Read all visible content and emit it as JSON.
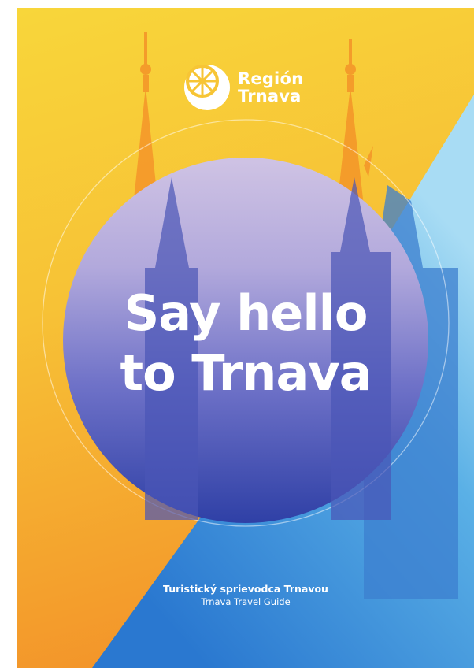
{
  "brand": {
    "line1": "Región",
    "line2": "Trnava"
  },
  "headline": {
    "line1": "Say hello",
    "line2": "to Trnava"
  },
  "footer": {
    "subtitle_sk": "Turistický sprievodca Trnavou",
    "subtitle_en": "Trnava Travel Guide"
  },
  "colors": {
    "yellow": "#f7d23a",
    "orange": "#f39a26",
    "blue": "#2d86d6",
    "light_blue": "#8fd0f2",
    "indigo": "#3446a9",
    "lavender": "#c6b8de"
  }
}
